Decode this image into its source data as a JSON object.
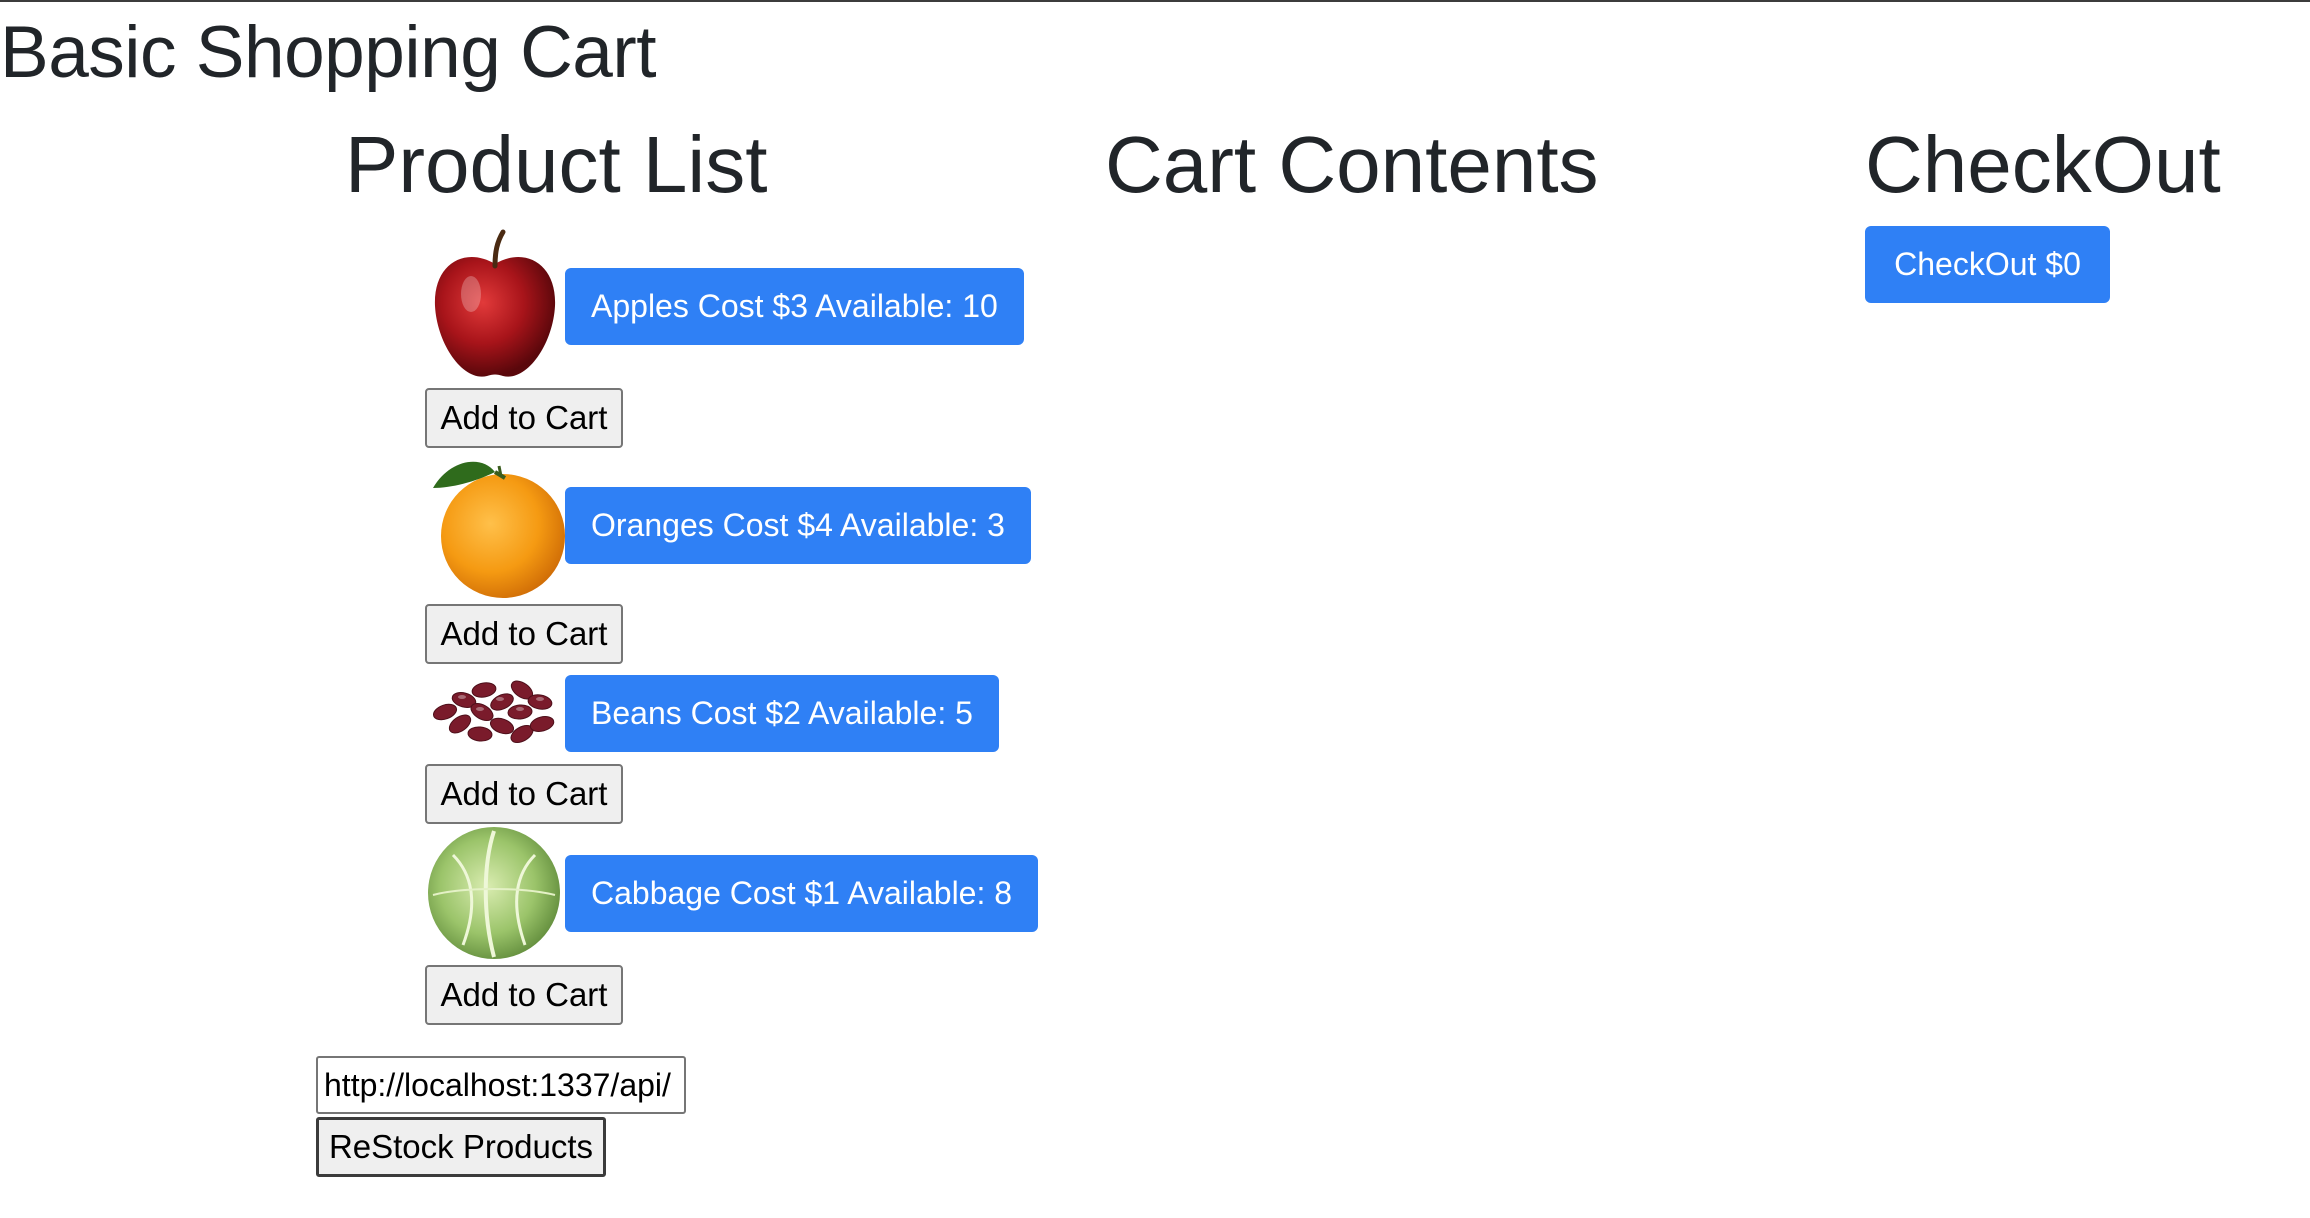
{
  "page": {
    "title": "Basic Shopping Cart"
  },
  "columns": {
    "product_list": "Product List",
    "cart_contents": "Cart Contents",
    "checkout": "CheckOut"
  },
  "products": [
    {
      "image": "apple",
      "info": "Apples Cost $3 Available: 10",
      "add_label": "Add to Cart"
    },
    {
      "image": "orange",
      "info": "Oranges Cost $4 Available: 3",
      "add_label": "Add to Cart"
    },
    {
      "image": "kidney-beans",
      "info": "Beans Cost $2 Available: 5",
      "add_label": "Add to Cart"
    },
    {
      "image": "cabbage",
      "info": "Cabbage Cost $1 Available: 8",
      "add_label": "Add to Cart"
    }
  ],
  "restock": {
    "url_value": "http://localhost:1337/api/",
    "button_label": "ReStock Products"
  },
  "checkout": {
    "button_label": "CheckOut $0"
  },
  "colors": {
    "primary": "#2f80f5",
    "text": "#212529"
  }
}
